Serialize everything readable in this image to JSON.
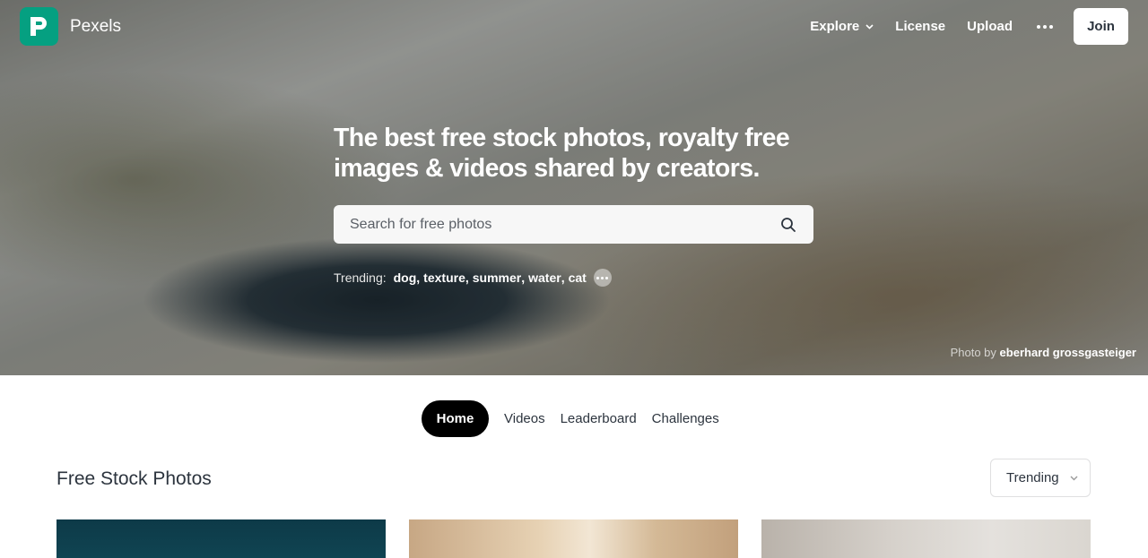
{
  "brand": {
    "name": "Pexels",
    "color": "#05a081"
  },
  "nav": {
    "explore": "Explore",
    "license": "License",
    "upload": "Upload",
    "more_icon": "more-horizontal-icon",
    "join": "Join"
  },
  "hero": {
    "headline_line1": "The best free stock photos, royalty free",
    "headline_line2": "images & videos shared by creators.",
    "search": {
      "placeholder": "Search for free photos",
      "value": "",
      "icon": "search-icon"
    },
    "trending": {
      "label": "Trending:",
      "tags": [
        "dog",
        "texture",
        "summer",
        "water",
        "cat"
      ]
    },
    "credit": {
      "prefix": "Photo by",
      "author": "eberhard grossgasteiger"
    }
  },
  "tabs": [
    {
      "label": "Home",
      "active": true
    },
    {
      "label": "Videos",
      "active": false
    },
    {
      "label": "Leaderboard",
      "active": false
    },
    {
      "label": "Challenges",
      "active": false
    }
  ],
  "section": {
    "title": "Free Stock Photos"
  },
  "sort": {
    "selected": "Trending"
  }
}
